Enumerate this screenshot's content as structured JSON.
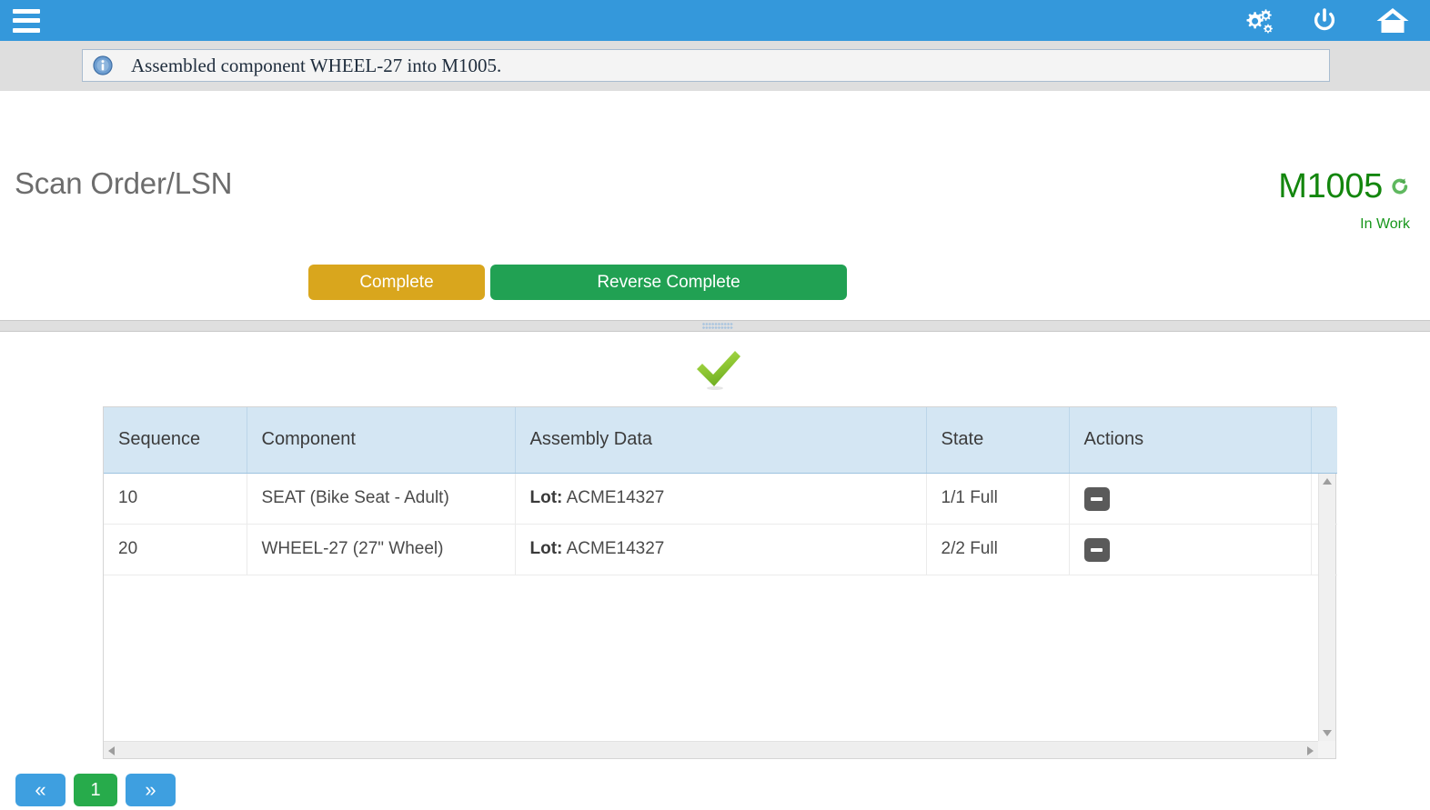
{
  "appbar": {
    "menu_icon": "hamburger-menu-icon",
    "settings_icon": "gears-icon",
    "power_icon": "power-icon",
    "home_icon": "home-icon",
    "bg_color": "#3498db"
  },
  "message": {
    "icon": "info-circle-icon",
    "text": "Assembled component WHEEL-27 into M1005."
  },
  "page": {
    "title": "Scan Order/LSN"
  },
  "order": {
    "id": "M1005",
    "status": "In Work",
    "refresh_icon": "refresh-icon",
    "id_color": "#13860d",
    "status_color": "#17961b"
  },
  "actions": {
    "complete_label": "Complete",
    "complete_color": "#d9a61d",
    "reverse_label": "Reverse Complete",
    "reverse_color": "#21a153"
  },
  "status_indicator": {
    "icon": "green-checkmark-icon"
  },
  "table": {
    "columns": [
      "Sequence",
      "Component",
      "Assembly Data",
      "State",
      "Actions"
    ],
    "rows": [
      {
        "sequence": "10",
        "component": "SEAT (Bike Seat - Adult)",
        "assembly_label": "Lot:",
        "assembly_value": "ACME14327",
        "state": "1/1 Full",
        "action_icon": "remove-icon"
      },
      {
        "sequence": "20",
        "component": "WHEEL-27 (27\" Wheel)",
        "assembly_label": "Lot:",
        "assembly_value": "ACME14327",
        "state": "2/2 Full",
        "action_icon": "remove-icon"
      }
    ],
    "header_bg": "#d4e6f3"
  },
  "scrollbars": {
    "up_icon": "arrow-up-icon",
    "down_icon": "arrow-down-icon",
    "left_icon": "arrow-left-icon",
    "right_icon": "arrow-right-icon"
  },
  "pagination": {
    "first_label": "«",
    "current_label": "1",
    "next_label": "»",
    "nav_color": "#3e9fe0",
    "current_color": "#27ab4b"
  }
}
